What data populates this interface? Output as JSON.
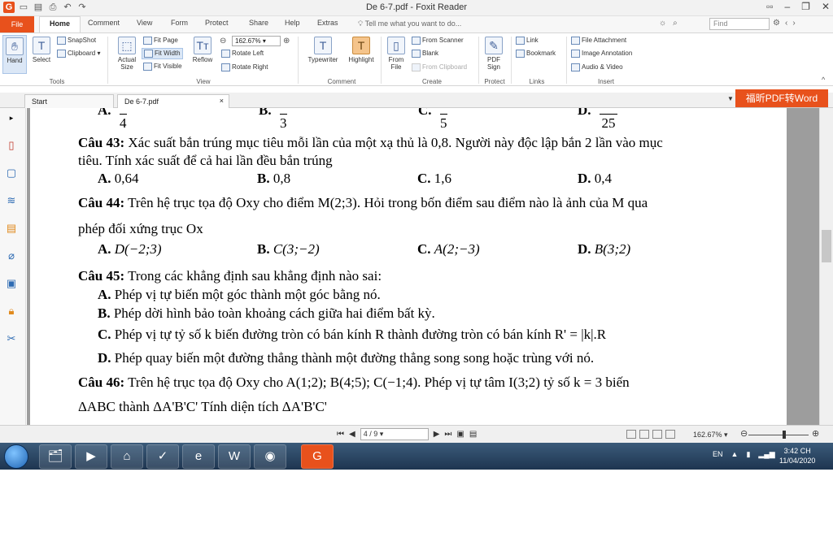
{
  "window": {
    "title": "De 6-7.pdf - Foxit Reader",
    "controls": [
      "▫▫",
      "–",
      "❐",
      "✕"
    ]
  },
  "ribbon_tabs": [
    "File",
    "Home",
    "Comment",
    "View",
    "Form",
    "Protect",
    "Share",
    "Help",
    "Extras"
  ],
  "tell_me": "Tell me what you want to do...",
  "find_placeholder": "Find",
  "ribbon": {
    "tools": {
      "hand": "Hand",
      "select": "Select",
      "snapshot": "SnapShot",
      "clipboard": "Clipboard",
      "actual_size": "Actual Size",
      "group": "Tools"
    },
    "view": {
      "fit_page": "Fit Page",
      "fit_width": "Fit Width",
      "fit_visible": "Fit Visible",
      "reflow": "Reflow",
      "zoom": "162.67%",
      "rotate_left": "Rotate Left",
      "rotate_right": "Rotate Right",
      "group": "View"
    },
    "comment": {
      "typewriter": "Typewriter",
      "highlight": "Highlight",
      "group": "Comment"
    },
    "create": {
      "from_file": "From File",
      "from_scanner": "From Scanner",
      "blank": "Blank",
      "from_clipboard": "From Clipboard",
      "group": "Create"
    },
    "protect": {
      "pdf_sign": "PDF Sign",
      "group": "Protect"
    },
    "links": {
      "link": "Link",
      "bookmark": "Bookmark",
      "group": "Links"
    },
    "insert": {
      "file_attachment": "File Attachment",
      "image_annotation": "Image Annotation",
      "audio_video": "Audio & Video",
      "group": "Insert"
    }
  },
  "doc_tabs": [
    {
      "label": "Start"
    },
    {
      "label": "De 6-7.pdf",
      "close": "×"
    }
  ],
  "convert_button": "福昕PDF转Word",
  "document": {
    "prev_fractions": {
      "a_num": "A.",
      "a_den": "4",
      "b_num": "B.",
      "b_den": "3",
      "c_num": "C.",
      "c_den": "5",
      "d_num": "D.",
      "d_den": "25"
    },
    "q43": {
      "label": "Câu 43:",
      "text1": "Xác suất bắn trúng mục tiêu mỗi lần của một xạ thủ là 0,8. Người này độc lập bắn 2 lần vào mục",
      "text2": "tiêu. Tính xác suất để cả hai lần đều bắn trúng",
      "answers": [
        {
          "key": "A.",
          "val": "0,64"
        },
        {
          "key": "B.",
          "val": "0,8"
        },
        {
          "key": "C.",
          "val": "1,6"
        },
        {
          "key": "D.",
          "val": "0,4"
        }
      ]
    },
    "q44": {
      "label": "Câu 44:",
      "text1": "Trên hệ trục tọa độ Oxy cho điểm M(2;3). Hỏi trong bốn điểm sau điểm nào là ảnh của M qua",
      "text2": "phép đối xứng trục Ox",
      "answers": [
        {
          "key": "A.",
          "val": "D(−2;3)"
        },
        {
          "key": "B.",
          "val": "C(3;−2)"
        },
        {
          "key": "C.",
          "val": "A(2;−3)"
        },
        {
          "key": "D.",
          "val": "B(3;2)"
        }
      ]
    },
    "q45": {
      "label": "Câu 45:",
      "text1": "Trong các khẳng định sau khẳng định nào sai:",
      "answers": [
        {
          "key": "A.",
          "val": "Phép vị tự biến một góc thành một góc bằng nó."
        },
        {
          "key": "B.",
          "val": "Phép dời hình bảo toàn khoảng cách giữa hai điểm bất kỳ."
        },
        {
          "key": "C.",
          "val": "Phép vị tự tỷ số k biến đường tròn có bán kính R thành đường tròn có bán kính R' = |k|.R"
        },
        {
          "key": "D.",
          "val": "Phép quay biến một đường thẳng thành một đường thẳng song song hoặc trùng với nó."
        }
      ]
    },
    "q46": {
      "label": "Câu 46:",
      "text1": "Trên hệ trục tọa độ Oxy cho A(1;2); B(4;5); C(−1;4). Phép vị tự tâm I(3;2) tỷ số k = 3 biến",
      "text2": "ΔABC thành ΔA'B'C' Tính diện tích ΔA'B'C'"
    }
  },
  "statusbar": {
    "page": "4 / 9",
    "zoom": "162.67%"
  },
  "taskbar": {
    "tray_lang": "EN",
    "time": "3:42 CH",
    "date": "11/04/2020"
  },
  "colors": {
    "accent": "#e8511c",
    "taskbar": "#2a4866"
  }
}
